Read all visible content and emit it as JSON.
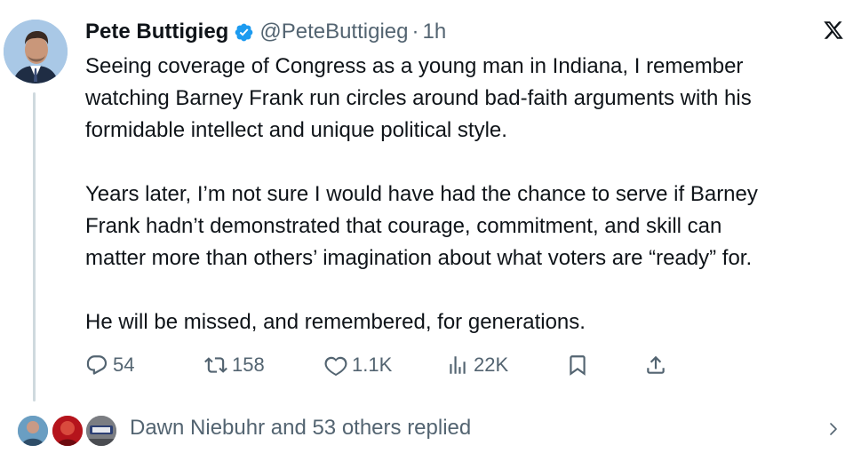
{
  "author": {
    "display_name": "Pete Buttigieg",
    "handle": "@PeteButtigieg",
    "separator": "·",
    "time": "1h",
    "verified_icon": "verified-badge-icon",
    "avatar_icon": "profile-photo"
  },
  "platform": {
    "logo_icon": "x-logo-icon"
  },
  "tweet": {
    "paragraphs": [
      "Seeing coverage of Congress as a young man in Indiana, I remember\nwatching Barney Frank run circles around bad-faith arguments with his\nformidable intellect and unique political style.",
      "Years later, I’m not sure I would have had the chance to serve if Barney\nFrank hadn’t demonstrated that courage, commitment, and skill can\nmatter more than others’ imagination about what voters are “ready” for.",
      "He will be missed, and remembered, for generations."
    ]
  },
  "actions": {
    "replies": "54",
    "reposts": "158",
    "likes": "1.1K",
    "views": "22K",
    "icons": [
      "reply-icon",
      "repost-icon",
      "like-icon",
      "views-icon",
      "bookmark-icon",
      "share-icon"
    ]
  },
  "replies_summary": {
    "text": "Dawn Niebuhr and 53 others replied"
  },
  "colors": {
    "text_primary": "#0f1419",
    "text_secondary": "#536471",
    "verified_blue": "#1d9bf0",
    "thread_line": "#cfd9de"
  }
}
